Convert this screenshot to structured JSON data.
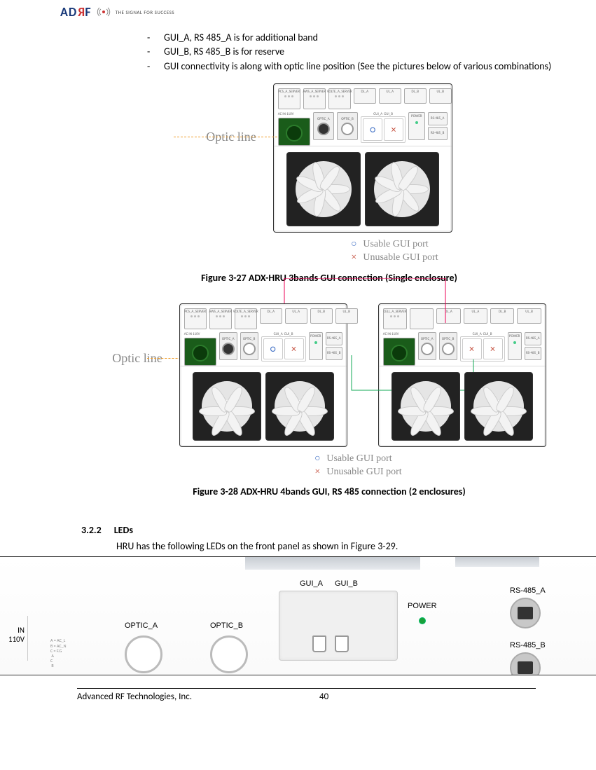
{
  "header": {
    "logo_text_pre": "AD",
    "logo_text_r": "R",
    "logo_text_post": "F",
    "tagline": "THE SIGNAL FOR SUCCESS"
  },
  "bullets": [
    "GUI_A, RS 485_A is for additional band",
    "GUI_B, RS 485_B  is for reserve",
    "GUI connectivity is along with optic line position (See the pictures below of various combinations)"
  ],
  "figures": {
    "optic_line_label": "Optic line",
    "legend_usable": "Usable GUI port",
    "legend_unusable": "Unusable GUI port",
    "fig1_caption": "Figure 3-27   ADX-HRU 3bands GUI connection (Single enclosure)",
    "fig2_caption": "Figure 3-28   ADX-HRU 4bands GUI, RS 485 connection (2 enclosures)",
    "device_slot_labels": {
      "pcs": "PCS_A_SERVER",
      "aws": "AWS_A_SERVER",
      "volte": "VOLTE_A_SERVER",
      "cell": "CELL_A_SERVER",
      "dl_a": "DL_A",
      "ul_a": "UL_A",
      "dl_b": "DL_B",
      "ul_b": "UL_B",
      "gui_a": "GUI_A",
      "gui_b": "GUI_B",
      "ac_in": "AC IN 110V",
      "optic_a": "OPTIC_A",
      "optic_b": "OPTIC_B",
      "power": "POWER",
      "rs_a": "RS-485_A",
      "rs_b": "RS-485_B"
    }
  },
  "section": {
    "num": "3.2.2",
    "title": "LEDs",
    "intro": "HRU has the following LEDs on the front panel as shown in Figure 3-29."
  },
  "panel": {
    "in110": "IN 110V",
    "optic_a": "OPTIC_A",
    "optic_b": "OPTIC_B",
    "gui_a": "GUI_A",
    "gui_b": "GUI_B",
    "power": "POWER",
    "rs_a": "RS-485_A",
    "rs_b": "RS-485_B",
    "tiny_lines": "A = AC_L\nB = AC_N\nC = F.G\n A\nC\n B"
  },
  "footer": {
    "company": "Advanced RF Technologies, Inc.",
    "page": "40"
  }
}
